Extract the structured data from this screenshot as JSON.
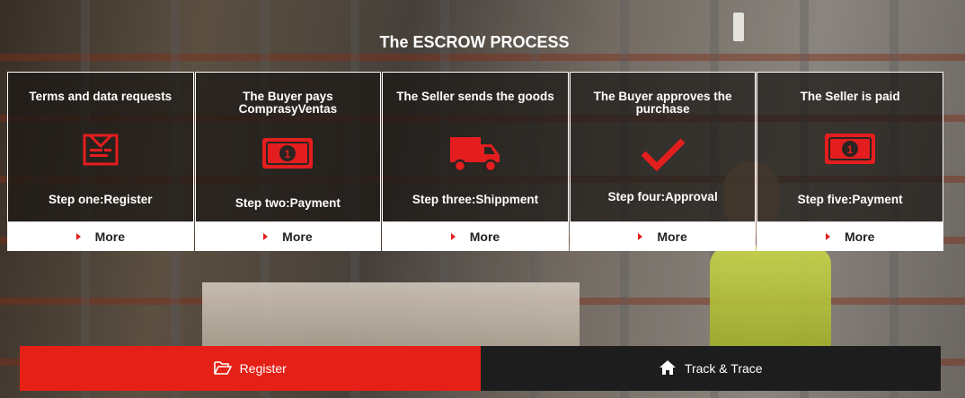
{
  "section_title": "The ESCROW PROCESS",
  "steps": [
    {
      "title": "Terms and data requests",
      "icon": "document-list-icon",
      "step": "Step one:Register",
      "more": "More"
    },
    {
      "title": "The Buyer pays ComprasyVentas",
      "icon": "money-bill-icon",
      "step": "Step two:Payment",
      "more": "More"
    },
    {
      "title": "The Seller sends the goods",
      "icon": "truck-icon",
      "step": "Step three:Shippment",
      "more": "More"
    },
    {
      "title": "The Buyer approves the purchase",
      "icon": "checkmark-icon",
      "step": "Step four:Approval",
      "more": "More"
    },
    {
      "title": "The Seller is paid",
      "icon": "money-bill-icon",
      "step": "Step five:Payment",
      "more": "More"
    }
  ],
  "bottom_bar": {
    "register_label": "Register",
    "register_icon": "folder-open-icon",
    "track_label": "Track & Trace",
    "track_icon": "home-icon"
  },
  "colors": {
    "accent_red": "#e52016",
    "dark_bar": "#1d1d1d",
    "icon_red": "#e41e1e"
  }
}
